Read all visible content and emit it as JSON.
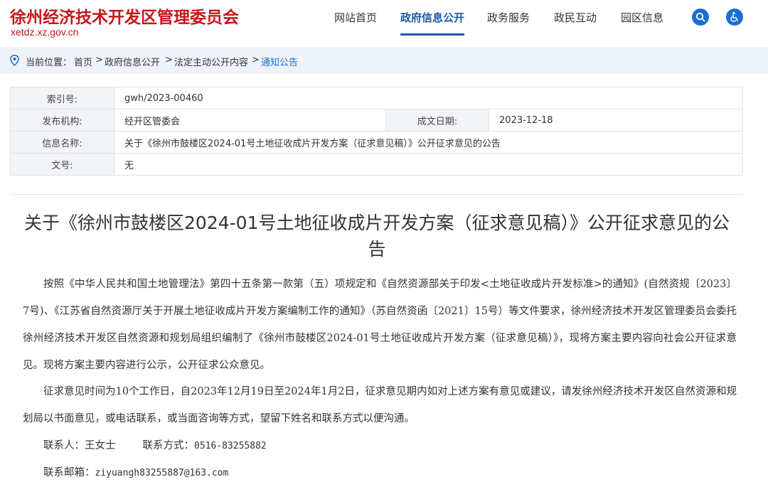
{
  "header": {
    "title": "徐州经济技术开发区管理委员会",
    "domain": "xetdz.xz.gov.cn",
    "nav": [
      "网站首页",
      "政府信息公开",
      "政务服务",
      "政民互动",
      "园区信息"
    ],
    "active_nav": "政府信息公开",
    "accent": "#1a5aa6",
    "brand_color": "#c8161d"
  },
  "breadcrumb": {
    "prefix": "当前位置：",
    "items": [
      "首页",
      "政府信息公开",
      "法定主动公开内容",
      "通知公告"
    ],
    "sep": ">"
  },
  "info": {
    "index_label": "索引号:",
    "index_value": "gwh/2023-00460",
    "org_label": "发布机构:",
    "org_value": "经开区管委会",
    "date_label": "成文日期:",
    "date_value": "2023-12-18",
    "name_label": "信息名称:",
    "name_value": "关于《徐州市鼓楼区2024-01号土地征收成片开发方案（征求意见稿）》公开征求意见的公告",
    "doc_label": "文号:",
    "doc_value": "无"
  },
  "article": {
    "title": "关于《徐州市鼓楼区2024-01号土地征收成片开发方案（征求意见稿）》公开征求意见的公告",
    "p1": "按照《中华人民共和国土地管理法》第四十五条第一款第（五）项规定和《自然资源部关于印发<土地征收成片开发标准>的通知》(自然资规〔2023〕7号)、《江苏省自然资源厅关于开展土地征收成片开发方案编制工作的通知》（苏自然资函〔2021〕15号）等文件要求，徐州经济技术开发区管理委员会委托徐州经济技术开发区自然资源和规划局组织编制了《徐州市鼓楼区2024-01号土地征收成片开发方案（征求意见稿）》，现将方案主要内容向社会公开征求意见。现将方案主要内容进行公示，公开征求公众意见。",
    "p2": "征求意见时间为10个工作日，自2023年12月19日至2024年1月2日，征求意见期内如对上述方案有意见或建议，请发徐州经济技术开发区自然资源和规划局以书面意见，或电话联系，或当面咨询等方式，望留下姓名和联系方式以便沟通。",
    "contact_label": "联系人：",
    "contact_name": "王女士",
    "phone_label": "联系方式：",
    "phone": "0516-83255882",
    "email_label": "联系邮箱：",
    "email": "ziyuangh83255887@163.com"
  }
}
